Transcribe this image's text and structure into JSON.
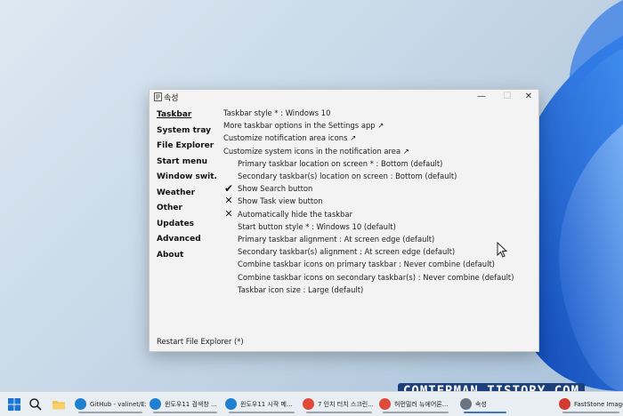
{
  "window": {
    "title": "속성",
    "controls": {
      "minimize": "—",
      "maximize": "☐",
      "close": "✕"
    }
  },
  "sidebar": {
    "items": [
      {
        "label": "Taskbar",
        "active": true
      },
      {
        "label": "System tray"
      },
      {
        "label": "File Explorer"
      },
      {
        "label": "Start menu"
      },
      {
        "label": "Window swit..."
      },
      {
        "label": "Weather"
      },
      {
        "label": "Other"
      },
      {
        "label": "Updates"
      },
      {
        "label": "Advanced"
      },
      {
        "label": "About"
      }
    ]
  },
  "settings": [
    {
      "text": "Taskbar style * : Windows 10",
      "indent": 0,
      "mark": ""
    },
    {
      "text": "More taskbar options in the Settings app ↗",
      "indent": 0,
      "mark": ""
    },
    {
      "text": "Customize notification area icons ↗",
      "indent": 0,
      "mark": ""
    },
    {
      "text": "Customize system icons in the notification area ↗",
      "indent": 0,
      "mark": ""
    },
    {
      "text": "Primary taskbar location on screen * : Bottom (default)",
      "indent": 1,
      "mark": ""
    },
    {
      "text": "Secondary taskbar(s) location on screen : Bottom (default)",
      "indent": 1,
      "mark": ""
    },
    {
      "text": "Show Search button",
      "indent": 1,
      "mark": "✔"
    },
    {
      "text": "Show Task view button",
      "indent": 1,
      "mark": "✕"
    },
    {
      "text": "Automatically hide the taskbar",
      "indent": 1,
      "mark": "✕"
    },
    {
      "text": "Start button style * : Windows 10 (default)",
      "indent": 1,
      "mark": ""
    },
    {
      "text": "Primary taskbar alignment : At screen edge (default)",
      "indent": 1,
      "mark": ""
    },
    {
      "text": "Secondary taskbar(s) alignment : At screen edge (default)",
      "indent": 1,
      "mark": ""
    },
    {
      "text": "Combine taskbar icons on primary taskbar : Never combine (default)",
      "indent": 1,
      "mark": ""
    },
    {
      "text": "Combine taskbar icons on secondary taskbar(s) : Never combine (default)",
      "indent": 1,
      "mark": ""
    },
    {
      "text": "Taskbar icon size : Large (default)",
      "indent": 1,
      "mark": ""
    }
  ],
  "footer": {
    "restart_label": "Restart File Explorer (*)"
  },
  "taskbar": {
    "apps": [
      {
        "label": "GitHub - valinet/Ex...",
        "icon": "edge-icon",
        "color": "#1f7fd1"
      },
      {
        "label": "윈도우11 검색창 ...",
        "icon": "edge-icon",
        "color": "#1f7fd1"
      },
      {
        "label": "윈도우11 시작 메...",
        "icon": "edge-icon",
        "color": "#1f7fd1"
      },
      {
        "label": "7 인치 터치 스크린...",
        "icon": "chrome-icon",
        "color": "#e04a3a"
      },
      {
        "label": "허먼밀러 뉴에어론...",
        "icon": "chrome-icon",
        "color": "#e04a3a"
      },
      {
        "label": "속성",
        "icon": "app-window-icon",
        "color": "#6a7480"
      },
      {
        "label": "FastStone Image V...",
        "icon": "faststone-icon",
        "color": "#d23b2e"
      }
    ]
  },
  "watermark": "COMTERMAN.TISTORY.COM"
}
